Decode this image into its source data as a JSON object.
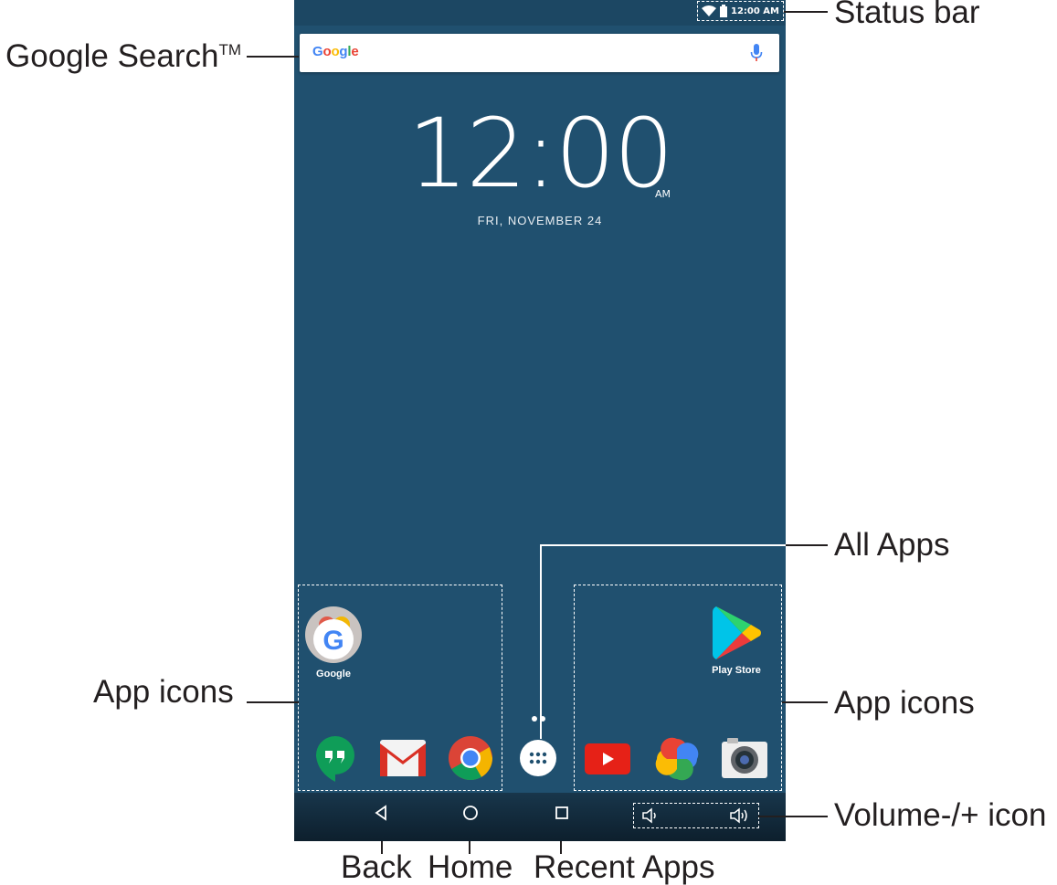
{
  "status_bar": {
    "time": "12:00 AM"
  },
  "search": {
    "logo": [
      "G",
      "o",
      "o",
      "g",
      "l",
      "e"
    ],
    "logo_colors": [
      "#4285F4",
      "#EA4335",
      "#FBBC05",
      "#4285F4",
      "#34A853",
      "#EA4335"
    ]
  },
  "clock": {
    "time": "12:00",
    "ampm": "AM",
    "date": "FRI, NOVEMBER 24"
  },
  "apps": {
    "google": "Google",
    "play_store": "Play Store"
  },
  "annotations": {
    "status_bar": "Status bar",
    "google_search": "Google Search",
    "google_search_tm": "TM",
    "all_apps": "All Apps",
    "app_icons_left": "App icons",
    "app_icons_right": "App icons",
    "volume": "Volume-/+ icon",
    "back": "Back",
    "home": "Home",
    "recent_apps": "Recent Apps"
  },
  "colors": {
    "screen": "#20506f",
    "status": "#1c4763",
    "text": "#231f20"
  }
}
